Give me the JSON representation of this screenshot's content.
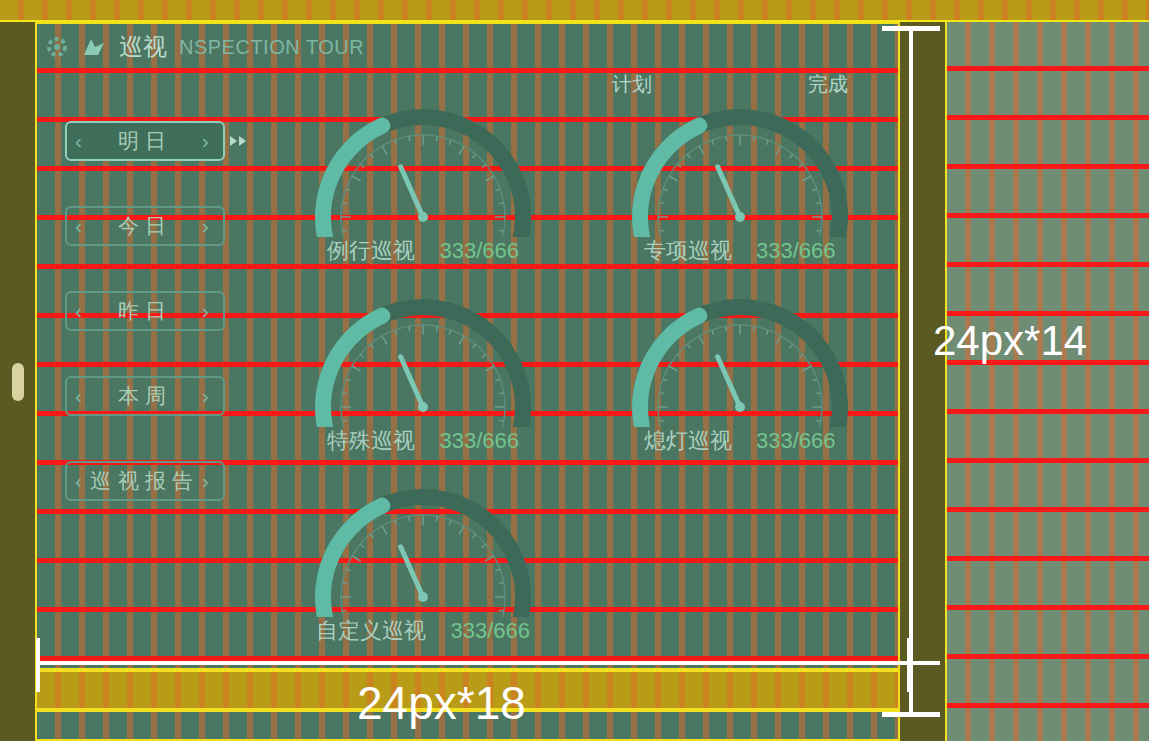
{
  "panel": {
    "title": "巡视",
    "subtitle": "NSPECTION TOUR",
    "columns": [
      "计划",
      "完成"
    ]
  },
  "date_buttons": [
    {
      "label": "明日",
      "selected": true
    },
    {
      "label": "今日",
      "selected": false
    },
    {
      "label": "昨日",
      "selected": false
    },
    {
      "label": "本周",
      "selected": false
    },
    {
      "label": "巡视报告",
      "selected": false
    }
  ],
  "gauges": [
    {
      "label": "例行巡视",
      "value": "333/666",
      "level": 0.4
    },
    {
      "label": "专项巡视",
      "value": "333/666",
      "level": 0.4
    },
    {
      "label": "特殊巡视",
      "value": "333/666",
      "level": 0.4
    },
    {
      "label": "熄灯巡视",
      "value": "333/666",
      "level": 0.4
    },
    {
      "label": "自定义巡视",
      "value": "333/666",
      "level": 0.4
    }
  ],
  "annotations": {
    "height": "24px*14",
    "width": "24px*18"
  }
}
